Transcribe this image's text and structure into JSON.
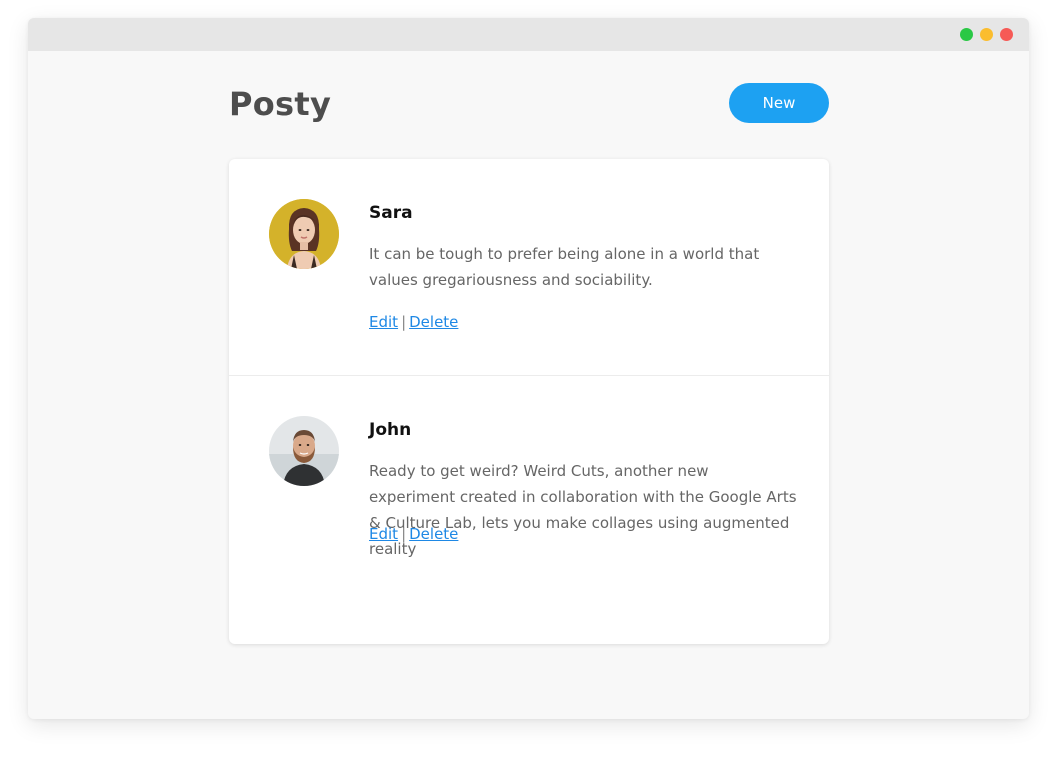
{
  "window": {
    "controls": [
      "green-dot",
      "yellow-dot",
      "red-dot"
    ]
  },
  "header": {
    "title": "Posty",
    "new_label": "New"
  },
  "posts": [
    {
      "author": "Sara",
      "text": "It can be tough to prefer being alone in a world that values gregariousness and sociability.",
      "edit_label": "Edit",
      "separator": "|",
      "delete_label": "Delete"
    },
    {
      "author": "John",
      "text": "Ready to get weird? Weird Cuts, another new experiment created in collaboration with the Google Arts & Culture Lab, lets you make collages using augmented reality",
      "edit_label": "Edit",
      "separator": "|",
      "delete_label": "Delete"
    }
  ],
  "colors": {
    "accent": "#1da1f2",
    "link": "#1e88e5",
    "title": "#4d4d4d"
  }
}
